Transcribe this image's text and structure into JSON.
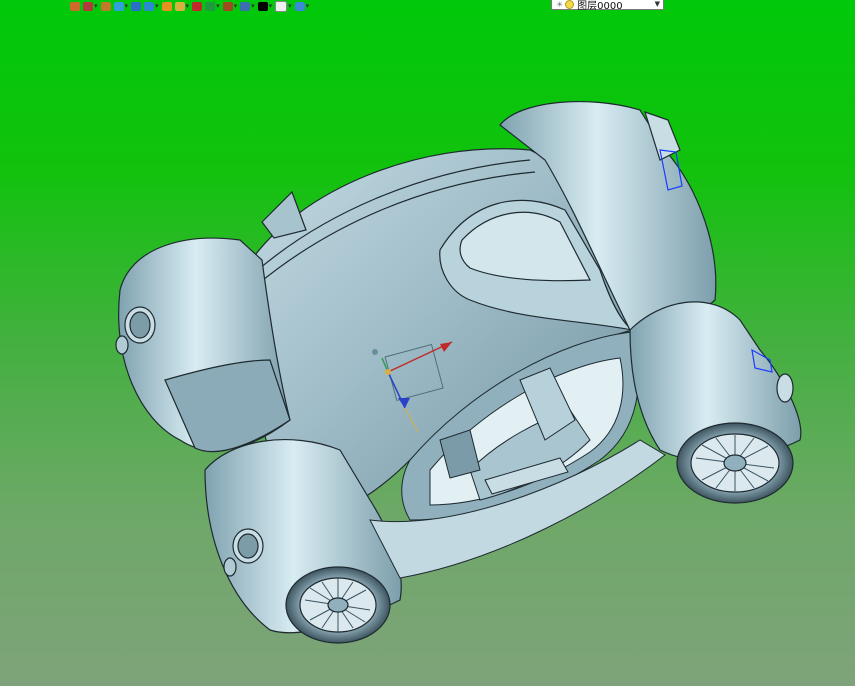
{
  "app": {
    "layer_field": {
      "value": "图层0000"
    }
  },
  "toolbar": {
    "buttons": [
      {
        "icon": "open-file-icon",
        "color": "#d06a2a"
      },
      {
        "icon": "snap-icon",
        "color": "#b23a3a"
      },
      {
        "icon": "pencil-sketch-icon",
        "color": "#c07a2a"
      },
      {
        "icon": "box-solid-icon",
        "color": "#30a0d8"
      },
      {
        "icon": "cube-display-icon",
        "color": "#2a70c8"
      },
      {
        "icon": "cube-shade-icon",
        "color": "#2a8ad0"
      },
      {
        "icon": "sphere-color-icon",
        "color": "#e89020"
      },
      {
        "icon": "clipboard-icon",
        "color": "#d8b040"
      },
      {
        "icon": "move-axes-icon",
        "color": "#c02a2a"
      },
      {
        "icon": "green-frame-icon",
        "color": "#209a40"
      },
      {
        "icon": "section-box-icon",
        "color": "#a04a20"
      },
      {
        "icon": "monitor-icon",
        "color": "#3a70b0"
      },
      {
        "icon": "black-square-icon",
        "color": "#000000"
      },
      {
        "icon": "white-page-icon",
        "color": "#f0f0f0"
      },
      {
        "icon": "layers-icon",
        "color": "#3a8ad8"
      }
    ]
  },
  "viewport": {
    "background_top": "#00c80a",
    "background_bottom": "#7ea37a",
    "model_color": "#9ab8c4",
    "model_shadow": "#6a8e9c",
    "model_highlight": "#d8ecf2",
    "edge_color": "#1e2a30"
  }
}
